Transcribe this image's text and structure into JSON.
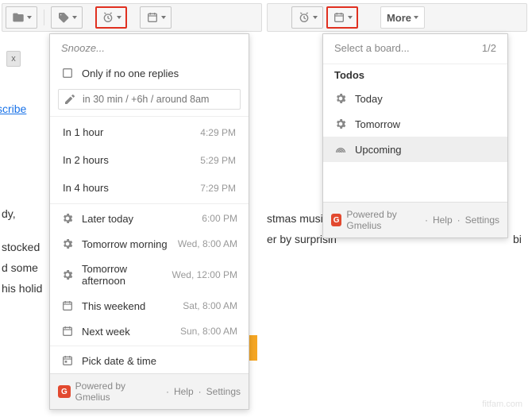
{
  "toolbar_left": {
    "folder": "folder-icon",
    "tag": "tag-icon",
    "snooze": "alarm-icon",
    "calendar": "calendar-icon"
  },
  "toolbar_right": {
    "snooze": "alarm-icon",
    "calendar": "calendar-icon",
    "more": "More"
  },
  "snooze_menu": {
    "title": "Snooze...",
    "only_if": "Only if no one replies",
    "custom_placeholder": "in 30 min / +6h / around 8am",
    "rows_time": [
      {
        "label": "In 1 hour",
        "time": "4:29 PM"
      },
      {
        "label": "In 2 hours",
        "time": "5:29 PM"
      },
      {
        "label": "In 4 hours",
        "time": "7:29 PM"
      }
    ],
    "rows_day": [
      {
        "label": "Later today",
        "time": "6:00 PM",
        "icon": "gear-icon"
      },
      {
        "label": "Tomorrow morning",
        "time": "Wed, 8:00 AM",
        "icon": "gear-icon"
      },
      {
        "label": "Tomorrow afternoon",
        "time": "Wed, 12:00 PM",
        "icon": "gear-icon"
      },
      {
        "label": "This weekend",
        "time": "Sat, 8:00 AM",
        "icon": "calendar-icon"
      },
      {
        "label": "Next week",
        "time": "Sun, 8:00 AM",
        "icon": "calendar-icon"
      }
    ],
    "pick": "Pick date & time"
  },
  "board_menu": {
    "select": "Select a board...",
    "page": "1/2",
    "group": "Todos",
    "items": [
      {
        "label": "Today",
        "icon": "gear-icon"
      },
      {
        "label": "Tomorrow",
        "icon": "gear-icon"
      },
      {
        "label": "Upcoming",
        "icon": "rainbow-icon",
        "selected": true
      }
    ]
  },
  "footer": {
    "powered": "Powered by Gmelius",
    "help": "Help",
    "settings": "Settings",
    "sep": "·"
  },
  "bg_left": {
    "x_chip": "x",
    "sub": "scribe",
    "l1": "dy,",
    "l2": "stocked",
    "l3": "d some",
    "l4": "his holid"
  },
  "bg_right": {
    "l1": "stmas music",
    "l2": "er by surprisin",
    "l2b": "bi"
  },
  "watermark": "fitfam.com"
}
